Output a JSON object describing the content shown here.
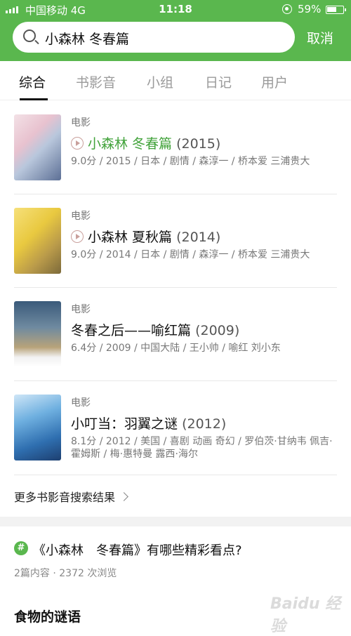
{
  "status_bar": {
    "carrier": "中国移动  4G",
    "time": "11:18",
    "battery": "59%"
  },
  "search": {
    "query": "小森林 冬春篇",
    "cancel_label": "取消"
  },
  "tabs": [
    {
      "label": "综合",
      "active": true
    },
    {
      "label": "书影音"
    },
    {
      "label": "小组"
    },
    {
      "label": "日记"
    },
    {
      "label": "用户"
    }
  ],
  "results": [
    {
      "category": "电影",
      "title": "小森林 冬春篇",
      "year": "(2015)",
      "playable": true,
      "highlight": true,
      "meta": "9.0分 / 2015 / 日本 / 剧情 / 森淳一 / 桥本爱 三浦贵大"
    },
    {
      "category": "电影",
      "title": "小森林 夏秋篇",
      "year": "(2014)",
      "playable": true,
      "highlight": false,
      "meta": "9.0分 / 2014 / 日本 / 剧情 / 森淳一 / 桥本爱 三浦贵大"
    },
    {
      "category": "电影",
      "title": "冬春之后——喻红篇",
      "year": "(2009)",
      "playable": false,
      "highlight": false,
      "meta": "6.4分 / 2009 / 中国大陆 / 王小帅 / 喻红 刘小东"
    },
    {
      "category": "电影",
      "title": "小叮当：羽翼之谜",
      "year": "(2012)",
      "playable": false,
      "highlight": false,
      "meta": "8.1分 / 2012 / 美国 / 喜剧 动画 奇幻 / 罗伯茨·甘纳韦 佩吉·霍姆斯 / 梅·惠特曼 露西·海尔"
    }
  ],
  "more_label": "更多书影音搜索结果",
  "topic": {
    "icon": "#",
    "title": "《小森林　冬春篇》有哪些精彩看点?",
    "meta": "2篇内容 · 2372 次浏览"
  },
  "next_section_title": "食物的谜语",
  "watermark": "Baidu 经验"
}
